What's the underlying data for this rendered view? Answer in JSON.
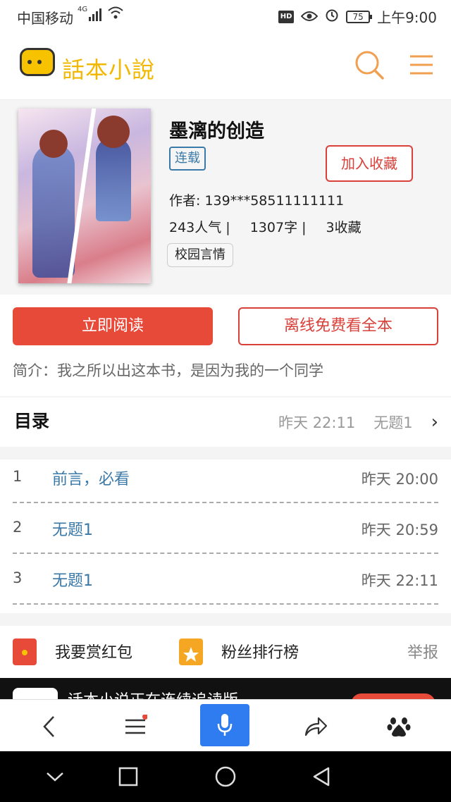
{
  "status_bar": {
    "carrier": "中国移动",
    "network": "4G",
    "battery": "75",
    "time": "上午9:00",
    "hd_label": "HD"
  },
  "header": {
    "logo_text": "話本小說",
    "accent_color": "#f0a050"
  },
  "book": {
    "title": "墨漓的创造",
    "status_tag": "连载",
    "collect_button": "加入收藏",
    "author": "作者: 139***58511111111",
    "popularity": "243人气 |",
    "word_count": "1307字 |",
    "favorites": "3收藏",
    "genre": "校园言情"
  },
  "actions": {
    "read_now": "立即阅读",
    "offline": "离线免费看全本"
  },
  "intro": "简介：我之所以出这本书，是因为我的一个同学",
  "toc": {
    "title": "目录",
    "latest_time": "昨天 22:11",
    "latest_chapter": "无题1",
    "chevron": "›",
    "chapters": [
      {
        "num": "1",
        "name": "前言，必看",
        "time": "昨天 20:00"
      },
      {
        "num": "2",
        "name": "无题1",
        "time": "昨天 20:59"
      },
      {
        "num": "3",
        "name": "无题1",
        "time": "昨天 22:11"
      }
    ]
  },
  "features": {
    "reward": "我要赏红包",
    "ranking": "粉丝排行榜",
    "report": "举报"
  },
  "banner": {
    "text": "话本小说正在连续追读版"
  }
}
